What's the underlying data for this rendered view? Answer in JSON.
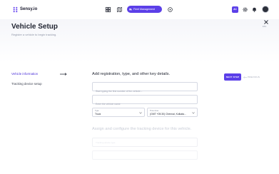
{
  "app": {
    "name": "Sensy.io"
  },
  "topbar": {
    "fleet_button": "Fleet Management",
    "badge": "AC"
  },
  "header": {
    "title": "Vehicle Setup",
    "subtitle": "Register a vehicle to begin tracking.",
    "close_label": "ESC"
  },
  "steps": [
    {
      "label": "Vehicle information",
      "active": true
    },
    {
      "label": "Tracking device setup",
      "active": false
    }
  ],
  "form": {
    "section_title": "Add registration, type, and other key details.",
    "registration_placeholder": "Start typing the first number of the vehicle...",
    "name_placeholder": "Enter the vehicle name",
    "type": {
      "label": "Type",
      "value": "Truck"
    },
    "timezone": {
      "label": "Time zone",
      "value": "(GMT +05:30) Chennai, Kolkata..."
    },
    "section2_title": "Assign and configure the tracking device for this vehicle.",
    "ghost_field": "Tracking device type"
  },
  "actions": {
    "next": "NEXT STEP",
    "previous": "PREVIOUS"
  },
  "colors": {
    "accent": "#5b3fe8",
    "active_step": "#4a2fd8"
  }
}
